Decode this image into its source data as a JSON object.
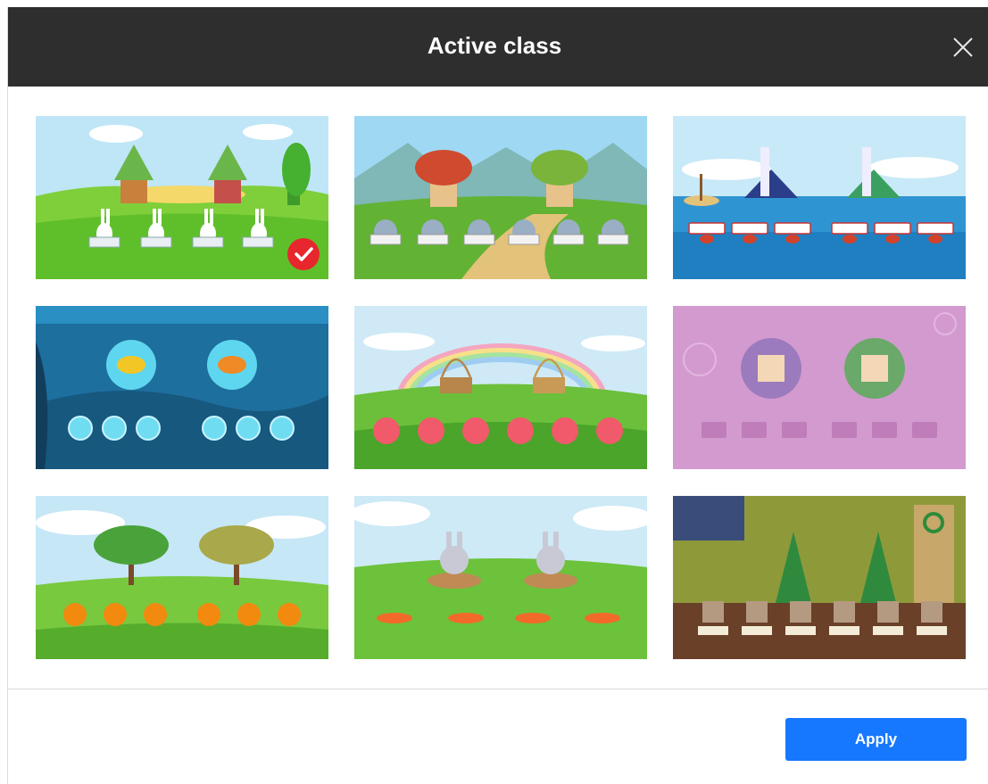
{
  "dialog": {
    "title": "Active class",
    "apply_label": "Apply",
    "selected_theme_index": 0
  },
  "themes": [
    {
      "name": "rabbits-mushroom-houses",
      "icon": "scene-thumbnail",
      "selected": true
    },
    {
      "name": "elephants-mushroom-houses",
      "icon": "scene-thumbnail",
      "selected": false
    },
    {
      "name": "crabs-lighthouses",
      "icon": "scene-thumbnail",
      "selected": false
    },
    {
      "name": "fish-bubbles",
      "icon": "scene-thumbnail",
      "selected": false
    },
    {
      "name": "peaches-baskets-rainbow",
      "icon": "scene-thumbnail",
      "selected": false
    },
    {
      "name": "scientists-lab",
      "icon": "scene-thumbnail",
      "selected": false
    },
    {
      "name": "oranges-trees",
      "icon": "scene-thumbnail",
      "selected": false
    },
    {
      "name": "bunnies-carrots",
      "icon": "scene-thumbnail",
      "selected": false
    },
    {
      "name": "dogs-christmas-trees",
      "icon": "scene-thumbnail",
      "selected": false
    }
  ],
  "colors": {
    "header_bg": "#2e2e2e",
    "accent": "#1677ff",
    "check": "#e8262d"
  }
}
